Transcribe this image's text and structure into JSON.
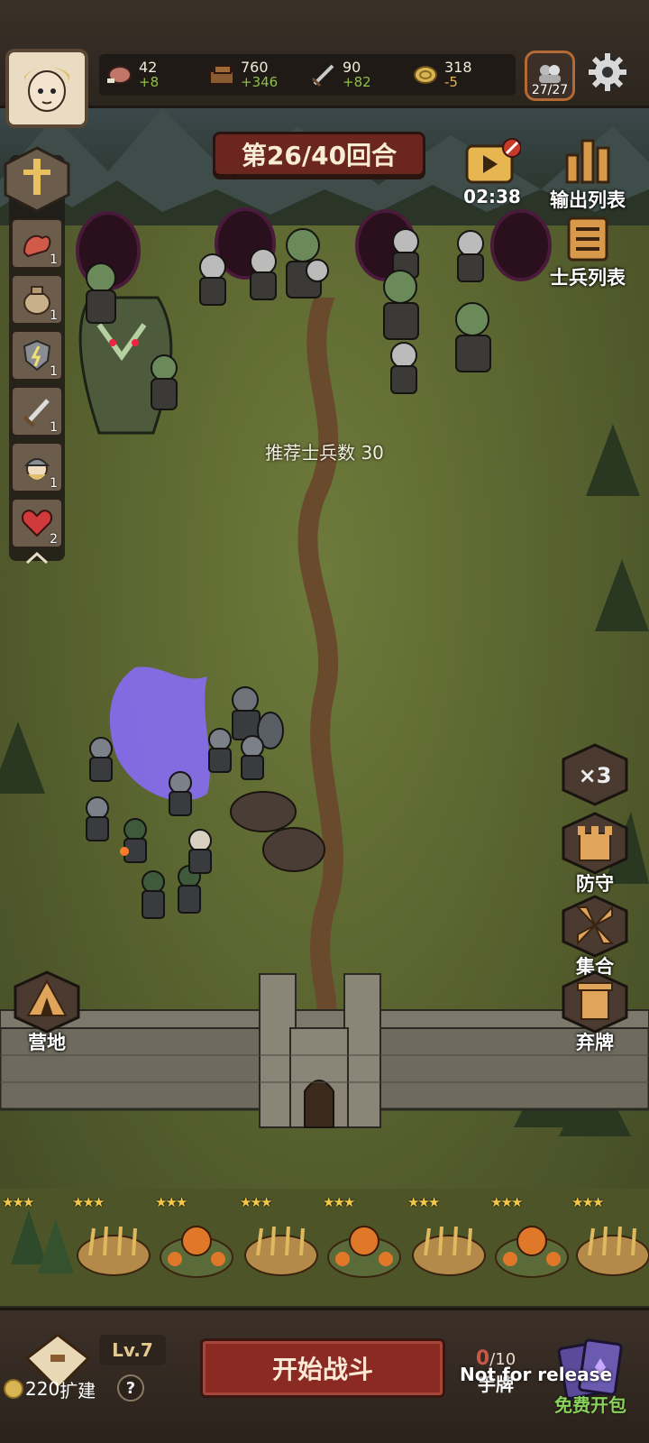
{
  "resources": [
    {
      "name": "meat",
      "icon": "meat-icon",
      "value": "42",
      "delta": "+8"
    },
    {
      "name": "wood",
      "icon": "wood-icon",
      "value": "760",
      "delta": "+346"
    },
    {
      "name": "iron",
      "icon": "sword-icon",
      "value": "90",
      "delta": "+82"
    },
    {
      "name": "gold",
      "icon": "coin-icon",
      "value": "318",
      "delta": "-5"
    }
  ],
  "troops": "27/27",
  "round": "第26/40回合",
  "timer": "02:38",
  "right_menu": {
    "output_list": "输出列表",
    "soldier_list": "士兵列表"
  },
  "recommend": "推荐士兵数 30",
  "perks": [
    {
      "icon": "muscle-icon",
      "count": "1"
    },
    {
      "icon": "sack-icon",
      "count": "1"
    },
    {
      "icon": "shield-bolt-icon",
      "count": "1"
    },
    {
      "icon": "dagger-icon",
      "count": "1"
    },
    {
      "icon": "viking-icon",
      "count": "1"
    },
    {
      "icon": "heart-icon",
      "count": "2"
    }
  ],
  "actions": {
    "speed": "×3",
    "defend": "防守",
    "gather": "集合",
    "discard": "弃牌",
    "camp": "营地"
  },
  "bottom": {
    "level": "Lv.7",
    "expand_cost": "220",
    "expand_label": "扩建",
    "help": "?",
    "start_battle": "开始战斗",
    "hand_count": "0",
    "hand_max": "/10",
    "hand_label": "手牌",
    "free_pack": "免费开包",
    "watermark": "Not for release"
  },
  "colors": {
    "accent_red": "#8a2a23",
    "delta_positive": "#8fbf4a",
    "star": "#f4c84a"
  }
}
